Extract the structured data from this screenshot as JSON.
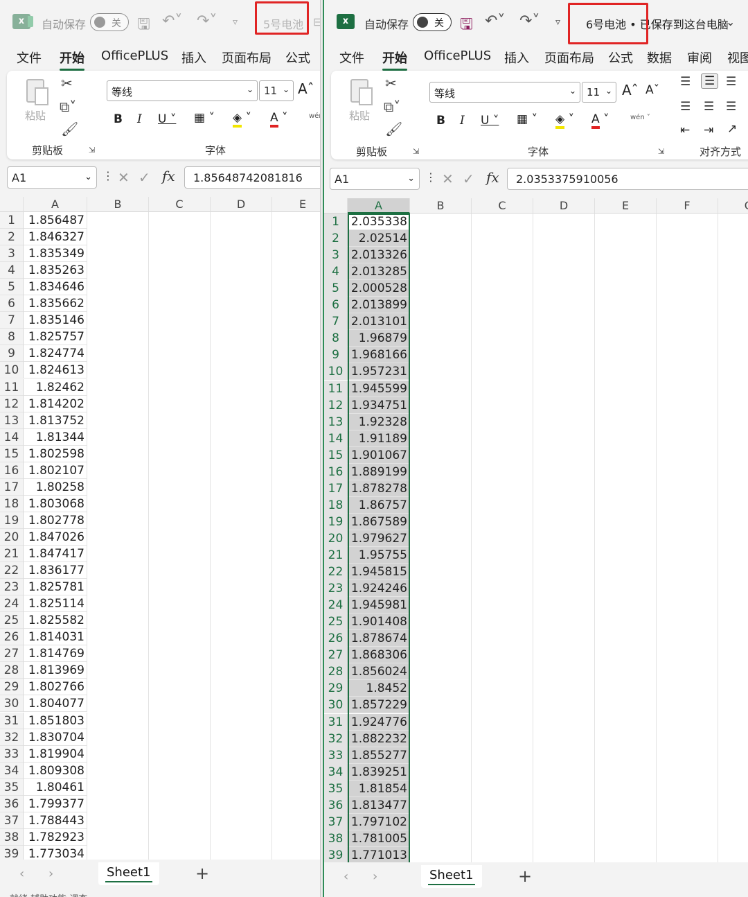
{
  "left": {
    "autosave_label": "自动保存",
    "toggle_label": "关",
    "filename": "5号电池",
    "tabs": [
      "文件",
      "开始",
      "OfficePLUS",
      "插入",
      "页面布局",
      "公式"
    ],
    "font_name": "等线",
    "font_size": "11",
    "group_clipboard": "剪贴板",
    "group_font": "字体",
    "paste_label": "粘贴",
    "name_box": "A1",
    "formula_value": "1.85648742081816",
    "columns": [
      "A",
      "B",
      "C",
      "D",
      "E"
    ],
    "rows": [
      "1",
      "2",
      "3",
      "4",
      "5",
      "6",
      "7",
      "8",
      "9",
      "10",
      "11",
      "12",
      "13",
      "14",
      "15",
      "16",
      "17",
      "18",
      "19",
      "20",
      "21",
      "22",
      "23",
      "24",
      "25",
      "26",
      "27",
      "28",
      "29",
      "30",
      "31",
      "32",
      "33",
      "34",
      "35",
      "36",
      "37",
      "38",
      "39"
    ],
    "values": [
      "1.856487",
      "1.846327",
      "1.835349",
      "1.835263",
      "1.834646",
      "1.835662",
      "1.835146",
      "1.825757",
      "1.824774",
      "1.824613",
      "1.82462",
      "1.814202",
      "1.813752",
      "1.81344",
      "1.802598",
      "1.802107",
      "1.80258",
      "1.803068",
      "1.802778",
      "1.847026",
      "1.847417",
      "1.836177",
      "1.825781",
      "1.825114",
      "1.825582",
      "1.814031",
      "1.814769",
      "1.813969",
      "1.802766",
      "1.804077",
      "1.851803",
      "1.830704",
      "1.819904",
      "1.809308",
      "1.80461",
      "1.799377",
      "1.788443",
      "1.782923",
      "1.773034"
    ],
    "sheet_tab": "Sheet1",
    "status": "就绪    辅助功能    调查"
  },
  "right": {
    "autosave_label": "自动保存",
    "toggle_label": "关",
    "filename": "6号电池 • 已保存到这台电脑",
    "tabs": [
      "文件",
      "开始",
      "OfficePLUS",
      "插入",
      "页面布局",
      "公式",
      "数据",
      "审阅",
      "视图"
    ],
    "font_name": "等线",
    "font_size": "11",
    "group_clipboard": "剪贴板",
    "group_font": "字体",
    "group_align": "对齐方式",
    "paste_label": "粘贴",
    "name_box": "A1",
    "formula_value": "2.0353375910056",
    "columns": [
      "A",
      "B",
      "C",
      "D",
      "E",
      "F",
      "G"
    ],
    "rows": [
      "1",
      "2",
      "3",
      "4",
      "5",
      "6",
      "7",
      "8",
      "9",
      "10",
      "11",
      "12",
      "13",
      "14",
      "15",
      "16",
      "17",
      "18",
      "19",
      "20",
      "21",
      "22",
      "23",
      "24",
      "25",
      "26",
      "27",
      "28",
      "29",
      "30",
      "31",
      "32",
      "33",
      "34",
      "35",
      "36",
      "37",
      "38",
      "39"
    ],
    "values": [
      "2.035338",
      "2.02514",
      "2.013326",
      "2.013285",
      "2.000528",
      "2.013899",
      "2.013101",
      "1.96879",
      "1.968166",
      "1.957231",
      "1.945599",
      "1.934751",
      "1.92328",
      "1.91189",
      "1.901067",
      "1.889199",
      "1.878278",
      "1.86757",
      "1.867589",
      "1.979627",
      "1.95755",
      "1.945815",
      "1.924246",
      "1.945981",
      "1.901408",
      "1.878674",
      "1.868306",
      "1.856024",
      "1.8452",
      "1.857229",
      "1.924776",
      "1.882232",
      "1.855277",
      "1.839251",
      "1.81854",
      "1.813477",
      "1.797102",
      "1.781005",
      "1.771013"
    ],
    "sheet_tab": "Sheet1"
  },
  "colors": {
    "excel_green": "#1d6f42",
    "highlight_red": "#e02424",
    "selection_gray": "#d2d2d2"
  },
  "icons": [
    "excel-logo-icon",
    "save-icon",
    "undo-icon",
    "redo-icon",
    "customize-qat-icon",
    "cut-icon",
    "copy-icon",
    "format-painter-icon",
    "bold-icon",
    "italic-icon",
    "underline-icon",
    "border-icon",
    "fill-color-icon",
    "font-color-icon",
    "phonetic-icon",
    "grow-font-icon",
    "shrink-font-icon",
    "align-icon",
    "fx-icon",
    "cancel-icon",
    "enter-icon",
    "add-sheet-icon"
  ]
}
